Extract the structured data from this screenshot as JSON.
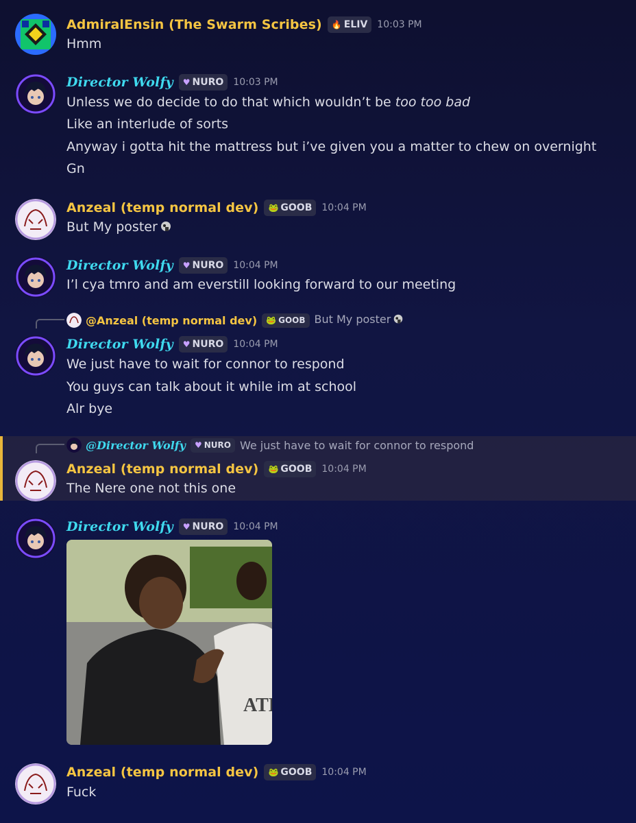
{
  "messages": [
    {
      "author": "AdmiralEnsin (The Swarm Scribes)",
      "tag": {
        "icon": "flame-glyph",
        "label": "ELIV"
      },
      "time": "10:03 PM",
      "lines": [
        "Hmm"
      ]
    },
    {
      "author": "Director Wolfy",
      "tag": {
        "icon": "purple-heart-glyph",
        "label": "NURO"
      },
      "time": "10:03 PM",
      "lines": [
        "Unless we do decide to do that which wouldn’t be ",
        "too too bad",
        "Like an interlude of sorts",
        "Anyway i gotta hit the mattress but i’ve given you a matter to chew on overnight",
        "Gn"
      ]
    },
    {
      "author": "Anzeal (temp normal dev)",
      "tag": {
        "icon": "frog-glyph",
        "label": "GOOB"
      },
      "time": "10:04 PM",
      "lines": [
        "But My poster"
      ]
    },
    {
      "author": "Director Wolfy",
      "tag": {
        "icon": "purple-heart-glyph",
        "label": "NURO"
      },
      "time": "10:04 PM",
      "lines": [
        "I’l cya tmro and am everstill looking forward to our meeting"
      ]
    },
    {
      "reply": {
        "name": "@Anzeal (temp normal dev)",
        "tag": "GOOB",
        "text": "But My poster"
      },
      "author": "Director Wolfy",
      "tag": {
        "icon": "purple-heart-glyph",
        "label": "NURO"
      },
      "time": "10:04 PM",
      "lines": [
        "We just have to wait for connor to respond",
        "You guys can talk about it while im at school",
        "Alr bye"
      ]
    },
    {
      "reply": {
        "name": "@Director Wolfy",
        "tag": "NURO",
        "text": "We just have to wait for connor to respond"
      },
      "author": "Anzeal (temp normal dev)",
      "tag": {
        "icon": "frog-glyph",
        "label": "GOOB"
      },
      "time": "10:04 PM",
      "lines": [
        "The Nere one not this one"
      ]
    },
    {
      "author": "Director Wolfy",
      "tag": {
        "icon": "purple-heart-glyph",
        "label": "NURO"
      },
      "time": "10:04 PM",
      "lines": []
    },
    {
      "author": "Anzeal (temp normal dev)",
      "tag": {
        "icon": "frog-glyph",
        "label": "GOOB"
      },
      "time": "10:04 PM",
      "lines": [
        "Fuck"
      ]
    }
  ],
  "colors": {
    "yellow_name": "#f5c542",
    "cyan_name": "#3fd9ee",
    "highlight_bar": "#e9b63a"
  }
}
